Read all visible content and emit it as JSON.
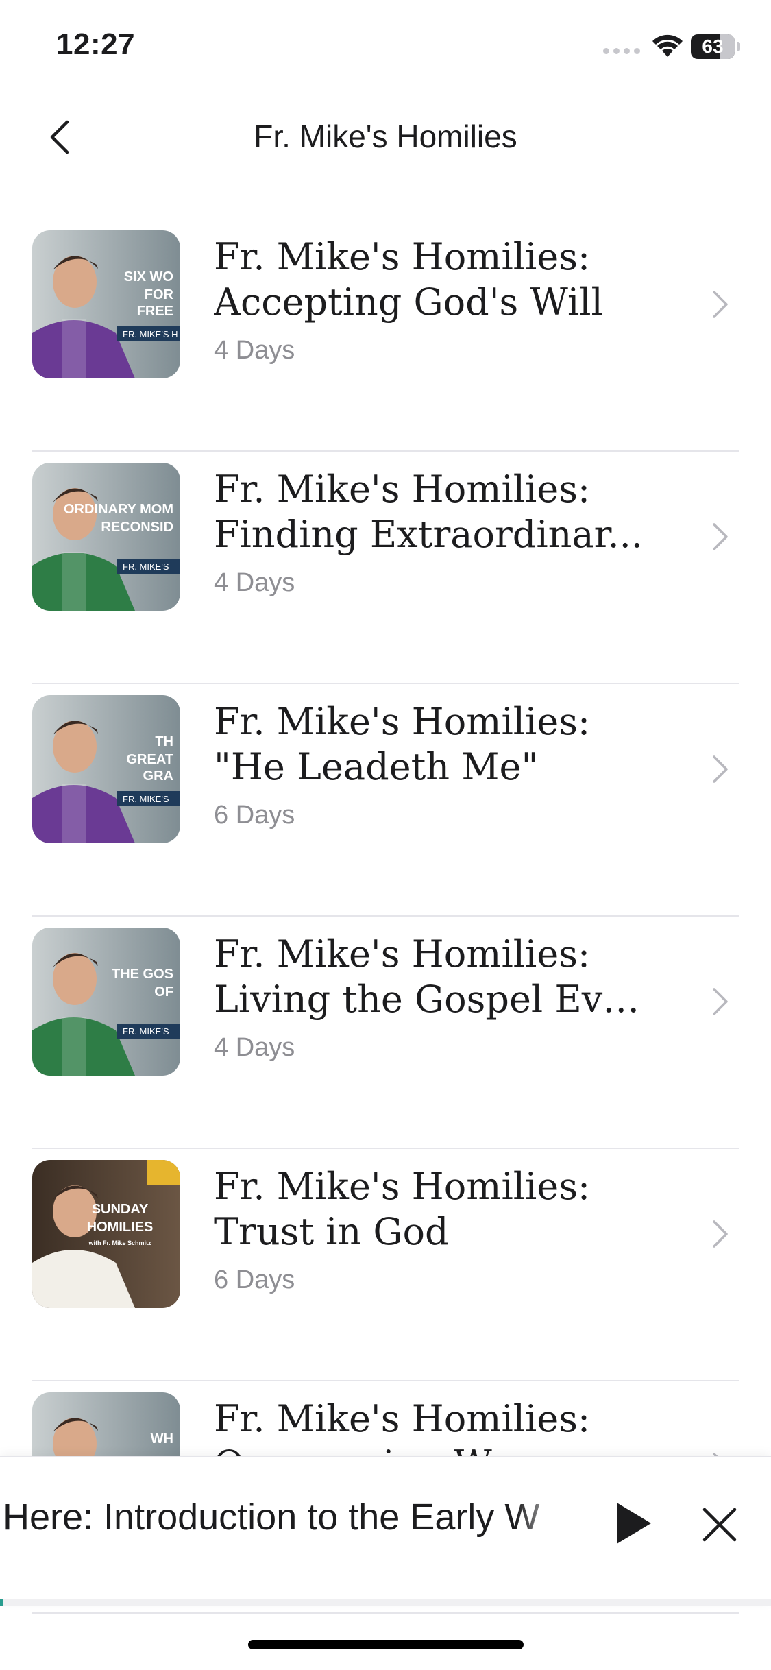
{
  "status_bar": {
    "time": "12:27",
    "battery": "63"
  },
  "header": {
    "title": "Fr. Mike's Homilies"
  },
  "items": [
    {
      "title_line1": "Fr. Mike's Homilies:",
      "title_line2": "Accepting God's Will",
      "subtitle": "4 Days",
      "thumb": {
        "overlay_lines": [
          "SIX WO",
          "FOR",
          "FREE"
        ],
        "tag": "FR. MIKE'S H",
        "vestment": "#6a3a94"
      }
    },
    {
      "title_line1": "Fr. Mike's Homilies:",
      "title_line2": "Finding Extraordinar...",
      "subtitle": "4 Days",
      "thumb": {
        "overlay_lines": [
          "ORDINARY MOM",
          "RECONSID"
        ],
        "tag": "FR. MIKE'S",
        "vestment": "#2e7d46"
      }
    },
    {
      "title_line1": "Fr. Mike's Homilies:",
      "title_line2": "\"He Leadeth Me\"",
      "subtitle": "6 Days",
      "thumb": {
        "overlay_lines": [
          "TH",
          "GREAT",
          "GRA"
        ],
        "tag": "FR. MIKE'S",
        "vestment": "#6a3a94"
      }
    },
    {
      "title_line1": "Fr. Mike's Homilies:",
      "title_line2": "Living the Gospel Eve...",
      "subtitle": "4 Days",
      "thumb": {
        "overlay_lines": [
          "THE GOS",
          "OF"
        ],
        "tag": "FR. MIKE'S",
        "vestment": "#2e7d46"
      }
    },
    {
      "title_line1": "Fr. Mike's Homilies:",
      "title_line2": "Trust in God",
      "subtitle": "6 Days",
      "thumb": {
        "overlay_lines": [
          "SUNDAY",
          "HOMILIES",
          "with Fr. Mike Schmitz"
        ],
        "tag": "",
        "vestment": "#f2efe8"
      }
    },
    {
      "title_line1": "Fr. Mike's Homilies:",
      "title_line2": "Overcoming W...",
      "subtitle": "",
      "thumb": {
        "overlay_lines": [
          "WH"
        ],
        "tag": "",
        "vestment": "#2e7d46"
      }
    }
  ],
  "player": {
    "title": "Here: Introduction to the Early W",
    "progress": 0.004
  },
  "colors": {
    "accent": "#2a9d8f",
    "purple": "#6a3a94",
    "green": "#2e7d46"
  },
  "icons": {
    "back": "chevron-left-icon",
    "row": "chevron-right-icon",
    "play": "play-icon",
    "close": "close-icon"
  }
}
